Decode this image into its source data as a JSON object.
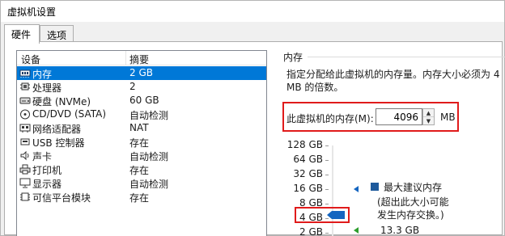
{
  "window": {
    "title": "虚拟机设置"
  },
  "tabs": [
    {
      "label": "硬件"
    },
    {
      "label": "选项"
    }
  ],
  "device_list": {
    "col_device": "设备",
    "col_summary": "摘要",
    "rows": [
      {
        "name": "内存",
        "summary": "2 GB",
        "icon": "memory-icon",
        "selected": true
      },
      {
        "name": "处理器",
        "summary": "2",
        "icon": "processor-icon",
        "selected": false
      },
      {
        "name": "硬盘 (NVMe)",
        "summary": "60 GB",
        "icon": "hard-disk-icon",
        "selected": false
      },
      {
        "name": "CD/DVD (SATA)",
        "summary": "自动检测",
        "icon": "cd-dvd-icon",
        "selected": false
      },
      {
        "name": "网络适配器",
        "summary": "NAT",
        "icon": "network-adapter-icon",
        "selected": false
      },
      {
        "name": "USB 控制器",
        "summary": "存在",
        "icon": "usb-controller-icon",
        "selected": false
      },
      {
        "name": "声卡",
        "summary": "自动检测",
        "icon": "sound-card-icon",
        "selected": false
      },
      {
        "name": "打印机",
        "summary": "存在",
        "icon": "printer-icon",
        "selected": false
      },
      {
        "name": "显示器",
        "summary": "自动检测",
        "icon": "display-icon",
        "selected": false
      },
      {
        "name": "可信平台模块",
        "summary": "存在",
        "icon": "tpm-icon",
        "selected": false
      }
    ]
  },
  "memory": {
    "group_title": "内存",
    "description": "指定分配给此虚拟机的内存量。内存大小必须为 4 MB 的倍数。",
    "field_label": "此虚拟机的内存(M):",
    "value": "4096",
    "unit": "MB",
    "scale_labels": [
      "128 GB",
      "64 GB",
      "32 GB",
      "16 GB",
      "8 GB",
      "4 GB",
      "2 GB"
    ],
    "legend_max_label": "最大建议内存",
    "legend_max_note_1": "(超出此大小可能",
    "legend_max_note_2": "发生内存交换。)",
    "legend_recommended_value": "13.3 GB",
    "colors": {
      "max_marker": "#1e5a9c",
      "current_thumb": "#1565c0",
      "recommended": "#2e9e2e",
      "highlight": "#e01b1b"
    }
  }
}
